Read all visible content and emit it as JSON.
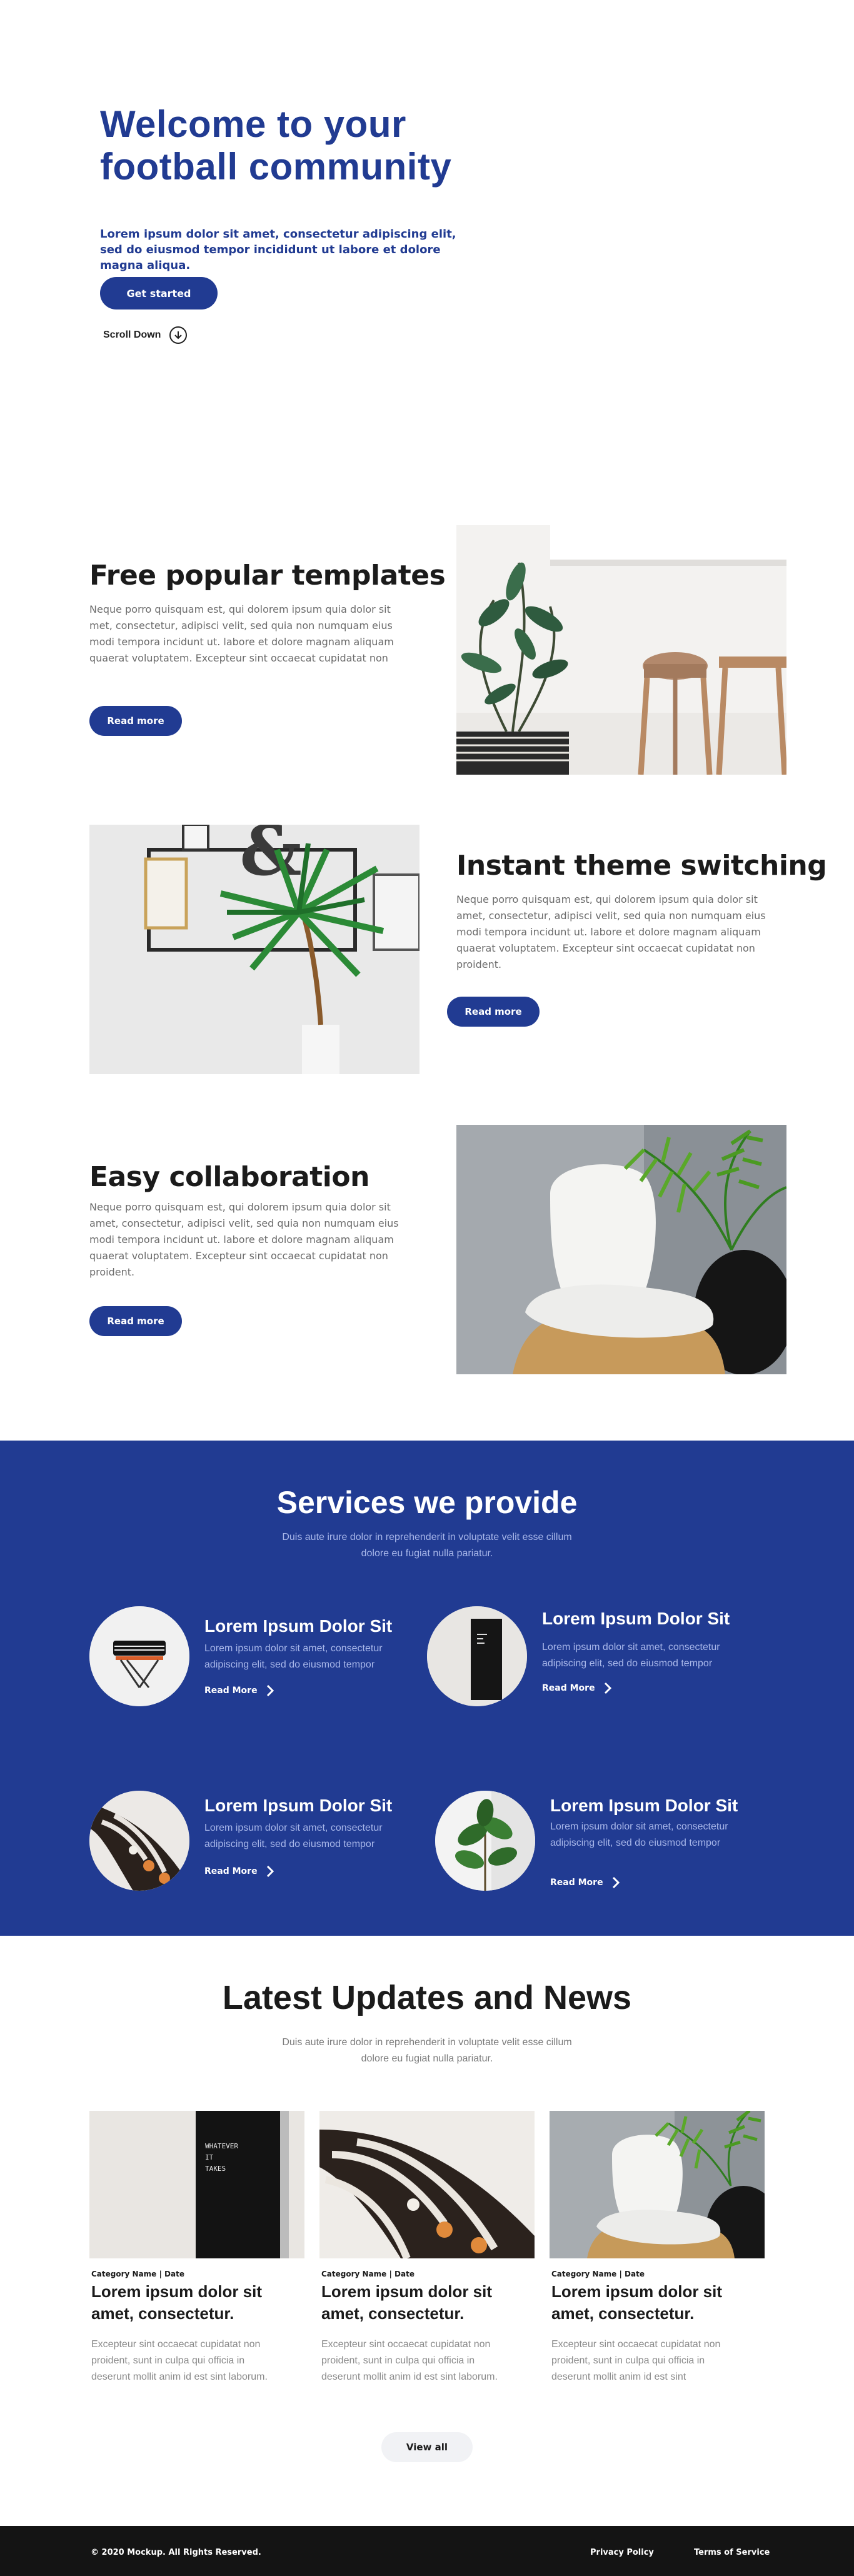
{
  "hero": {
    "title": "Welcome to your football community",
    "subtitle": "Lorem ipsum dolor sit amet, consectetur adipiscing elit, sed do eiusmod tempor incididunt ut labore et dolore magna aliqua.",
    "cta_label": "Get started",
    "scroll_label": "Scroll Down"
  },
  "features": [
    {
      "title": "Free popular templates",
      "text": "Neque porro quisquam est, qui dolorem ipsum quia dolor sit met, consectetur, adipisci velit, sed quia non numquam eius modi tempora incidunt ut. labore et dolore magnam aliquam quaerat voluptatem. Excepteur sint occaecat cupidatat non",
      "button": "Read more"
    },
    {
      "title": "Instant theme switching",
      "text": "Neque porro quisquam est, qui dolorem ipsum quia dolor sit amet, consectetur, adipisci velit, sed quia non numquam eius modi tempora incidunt ut. labore et dolore magnam aliquam quaerat voluptatem. Excepteur sint occaecat cupidatat non proident.",
      "button": "Read more"
    },
    {
      "title": "Easy collaboration",
      "text": "Neque porro quisquam est, qui dolorem ipsum quia dolor sit amet, consectetur, adipisci velit, sed quia non numquam eius modi tempora incidunt ut. labore et dolore magnam aliquam quaerat voluptatem. Excepteur sint occaecat cupidatat non proident.",
      "button": "Read more"
    }
  ],
  "services": {
    "title": "Services we provide",
    "subtitle": "Duis aute irure dolor in reprehenderit in voluptate velit esse cillum dolore eu fugiat nulla pariatur.",
    "items": [
      {
        "title": "Lorem Ipsum Dolor Sit",
        "text": "Lorem ipsum dolor sit amet, consectetur adipiscing elit, sed do eiusmod tempor",
        "more": "Read More"
      },
      {
        "title": "Lorem Ipsum Dolor Sit",
        "text": "Lorem ipsum dolor sit amet, consectetur adipiscing elit, sed do eiusmod tempor",
        "more": "Read More"
      },
      {
        "title": "Lorem Ipsum Dolor Sit",
        "text": "Lorem ipsum dolor sit amet, consectetur adipiscing elit, sed do eiusmod tempor",
        "more": "Read More"
      },
      {
        "title": "Lorem Ipsum Dolor Sit",
        "text": "Lorem ipsum dolor sit amet, consectetur adipiscing elit, sed do eiusmod tempor",
        "more": "Read More"
      }
    ]
  },
  "news": {
    "title": "Latest Updates and News",
    "subtitle": "Duis aute irure dolor in reprehenderit in voluptate velit esse cillum dolore eu fugiat nulla pariatur.",
    "cards": [
      {
        "meta": "Category Name  |  Date",
        "title": "Lorem ipsum dolor sit amet, consectetur.",
        "text": "Excepteur sint occaecat cupidatat non proident, sunt in culpa qui officia in deserunt mollit anim id est sint laborum."
      },
      {
        "meta": "Category Name  |  Date",
        "title": "Lorem ipsum dolor sit amet, consectetur.",
        "text": "Excepteur sint occaecat cupidatat non proident, sunt in culpa qui officia in deserunt mollit anim id est sint laborum."
      },
      {
        "meta": "Category Name  |  Date",
        "title": "Lorem ipsum dolor sit amet, consectetur.",
        "text": "Excepteur sint occaecat cupidatat non proident, sunt in culpa qui officia in deserunt mollit anim id est sint"
      }
    ],
    "letterboard_text": "WHATEVER IT TAKES",
    "view_all": "View all"
  },
  "footer": {
    "copyright": "© 2020 Mockup.  All Rights Reserved.",
    "privacy": "Privacy Policy",
    "terms": "Terms of Service"
  },
  "colors": {
    "brand": "#213b92",
    "footer": "#141414",
    "service_text": "#a8b7ea"
  },
  "icons": {
    "scroll": "arrow-down-circle-icon",
    "more": "chevron-right-icon"
  }
}
